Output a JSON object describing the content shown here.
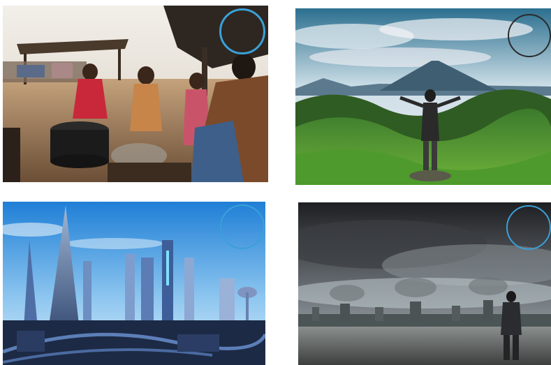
{
  "panels": [
    {
      "scene": "village-cooking",
      "ring_color": "#3aa0d8"
    },
    {
      "scene": "volcano-green-hills",
      "ring_color": "#2a2a2a"
    },
    {
      "scene": "futuristic-city",
      "ring_color": "#3aa0d8"
    },
    {
      "scene": "polluted-city-storm",
      "ring_color": "#3aa0d8"
    }
  ]
}
